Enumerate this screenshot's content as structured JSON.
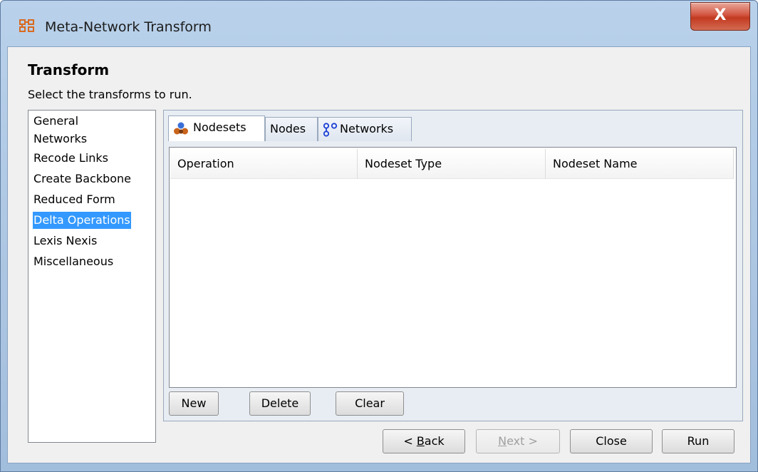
{
  "window": {
    "title": "Meta-Network Transform",
    "close_label": "X"
  },
  "page": {
    "heading": "Transform",
    "subheading": "Select the transforms to run."
  },
  "categories": [
    {
      "label": "General"
    },
    {
      "label": "Networks"
    },
    {
      "label": "Recode Links"
    },
    {
      "label": "Create Backbone"
    },
    {
      "label": "Reduced Form"
    },
    {
      "label": "Delta Operations",
      "selected": true
    },
    {
      "label": "Lexis Nexis"
    },
    {
      "label": "Miscellaneous"
    }
  ],
  "tabs": [
    {
      "label": "Nodesets",
      "icon": "nodesets-icon",
      "active": true
    },
    {
      "label": "Nodes",
      "icon": "",
      "active": false
    },
    {
      "label": "Networks",
      "icon": "network-icon",
      "active": false
    }
  ],
  "table": {
    "columns": [
      "Operation",
      "Nodeset Type",
      "Nodeset Name"
    ],
    "rows": []
  },
  "table_buttons": {
    "new": "New",
    "delete": "Delete",
    "clear": "Clear"
  },
  "footer_buttons": {
    "back_prefix": "< ",
    "back_mnemonic": "B",
    "back_rest": "ack",
    "next_mnemonic": "N",
    "next_rest": "ext >",
    "close": "Close",
    "run": "Run"
  },
  "colors": {
    "selection": "#3399ff",
    "title_icon": "#d9691f",
    "nodesets_icon": "#c9641c",
    "network_icon": "#1b3fd6"
  }
}
